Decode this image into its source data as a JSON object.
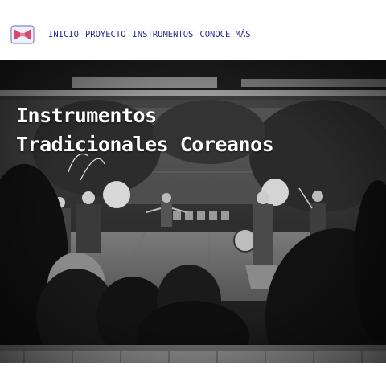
{
  "header": {
    "logo_icon": "janggu-drum-icon",
    "accent": "#d64a6e",
    "nav_color": "#2b2a8f",
    "nav": [
      {
        "label": "INICIO"
      },
      {
        "label": "PROYECTO"
      },
      {
        "label": "INSTRUMENTOS"
      },
      {
        "label": "CONOCE MÁS"
      }
    ]
  },
  "hero": {
    "title_line1": "Instrumentos",
    "title_line2": "Tradicionales Coreanos"
  }
}
